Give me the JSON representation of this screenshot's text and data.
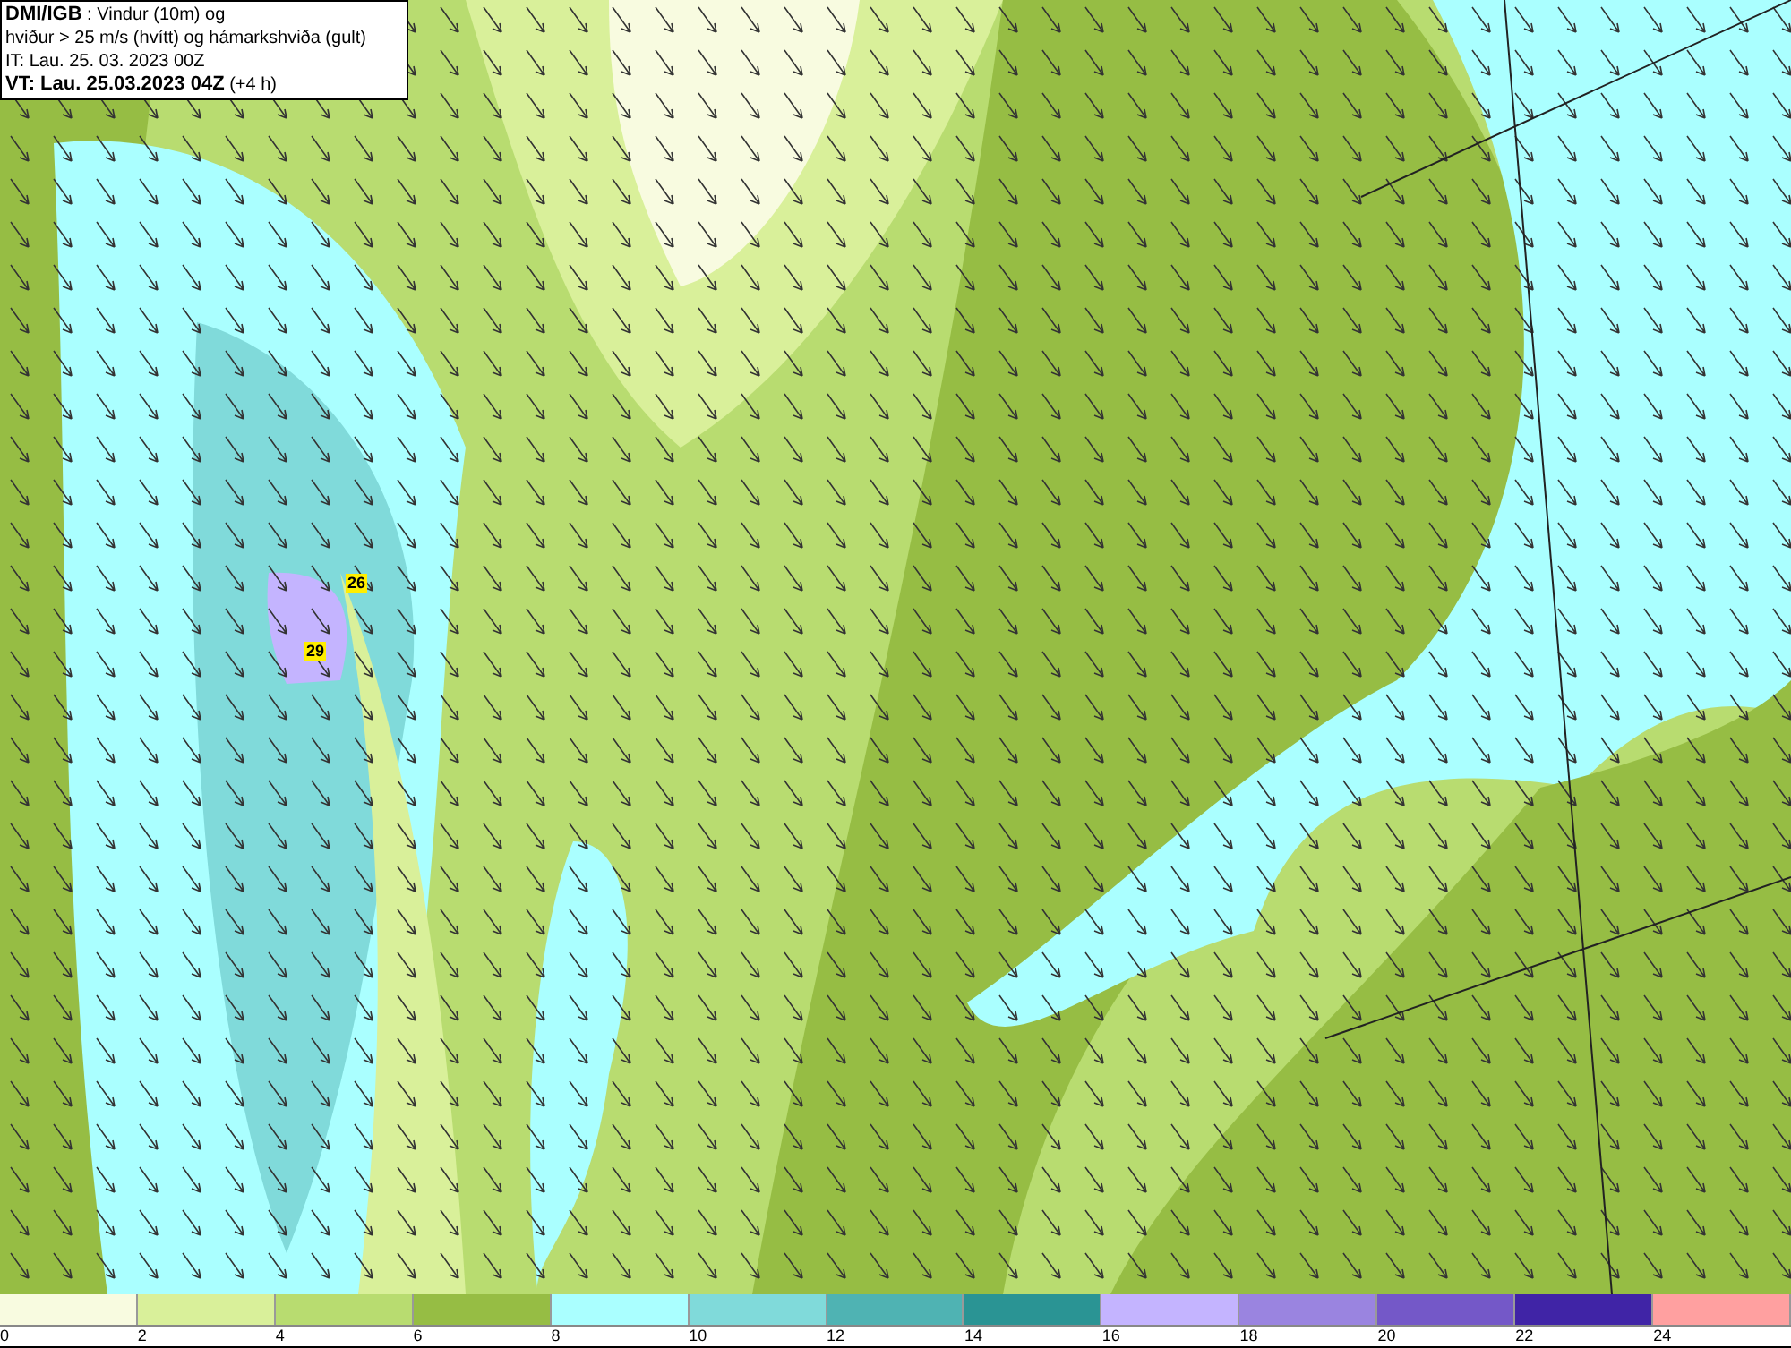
{
  "header": {
    "source": "DMI/IGB",
    "title_rest": " : Vindur (10m) og",
    "line_2": "hviður > 25 m/s (hvítt) og hámarkshviða (gult)",
    "issue_time": "IT: Lau. 25. 03. 2023 00Z",
    "valid_time": "VT: Lau. 25.03.2023 04Z",
    "offset": " (+4 h)"
  },
  "gust_labels": [
    {
      "text": "26"
    },
    {
      "text": "29"
    }
  ],
  "legend": [
    {
      "color": "#f8fbe0",
      "tick": "0"
    },
    {
      "color": "#d9f09a",
      "tick": "2"
    },
    {
      "color": "#b8dc70",
      "tick": "4"
    },
    {
      "color": "#96bd44",
      "tick": "6"
    },
    {
      "color": "#aaffff",
      "tick": "8"
    },
    {
      "color": "#80dada",
      "tick": "10"
    },
    {
      "color": "#4fb3b3",
      "tick": "12"
    },
    {
      "color": "#2a9494",
      "tick": "14"
    },
    {
      "color": "#c4b4ff",
      "tick": "16"
    },
    {
      "color": "#9a84e0",
      "tick": "18"
    },
    {
      "color": "#7458c8",
      "tick": "20"
    },
    {
      "color": "#4024a6",
      "tick": "22"
    },
    {
      "color": "#ffa0a0",
      "tick": "24"
    }
  ]
}
